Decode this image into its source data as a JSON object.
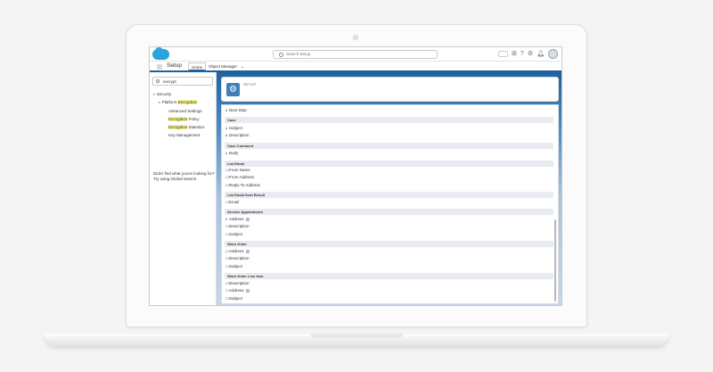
{
  "header": {
    "search_placeholder": "Search Setup",
    "icons": [
      "favorites-icon",
      "add-icon",
      "help-icon",
      "gear-icon",
      "bell-icon",
      "avatar"
    ]
  },
  "nav": {
    "app_name": "Setup",
    "tabs": [
      {
        "label": "Home",
        "active": true
      },
      {
        "label": "Object Manager"
      }
    ]
  },
  "sidebar": {
    "quick_find": "encrypt",
    "tree": {
      "security": "Security",
      "platform_pre": "Platform ",
      "platform_hl": "Encryption",
      "advanced": "Advanced Settings",
      "policy_hl": "Encryption",
      "policy_rest": " Policy",
      "stats_hl": "Encryption",
      "stats_rest": " Statistics",
      "key_mgmt": "Key Management"
    },
    "help_text": "Didn't find what you're looking for? Try using Global Search."
  },
  "main": {
    "setup_label": "SETUP",
    "sections": [
      {
        "title": "Case",
        "fields": [
          {
            "mark": "#",
            "label": "Subject"
          },
          {
            "mark": "#",
            "label": "Description"
          }
        ]
      },
      {
        "title": "Case Comment",
        "fields": [
          {
            "mark": "#",
            "label": "Body"
          }
        ]
      },
      {
        "title": "List Email",
        "fields": [
          {
            "mark": "☐",
            "label": "From Name"
          },
          {
            "mark": "☐",
            "label": "From Address"
          },
          {
            "mark": "☐",
            "label": "Reply To Address"
          }
        ]
      },
      {
        "title": "List Email Sent Result",
        "fields": [
          {
            "mark": "☐",
            "label": "Email"
          }
        ]
      },
      {
        "title": "Service Appointment",
        "fields": [
          {
            "mark": "#",
            "label": "Address"
          },
          {
            "mark": "☐",
            "label": "Description"
          },
          {
            "mark": "☐",
            "label": "Subject"
          }
        ]
      },
      {
        "title": "Work Order",
        "fields": [
          {
            "mark": "☐",
            "label": "Address"
          },
          {
            "mark": "☐",
            "label": "Description"
          },
          {
            "mark": "☐",
            "label": "Subject"
          }
        ]
      },
      {
        "title": "Work Order Line Item",
        "fields": [
          {
            "mark": "☐",
            "label": "Description"
          },
          {
            "mark": "☐",
            "label": "Address"
          },
          {
            "mark": "☐",
            "label": "Subject"
          }
        ]
      }
    ],
    "top_field": {
      "mark": "#",
      "label": "Next Step"
    }
  }
}
